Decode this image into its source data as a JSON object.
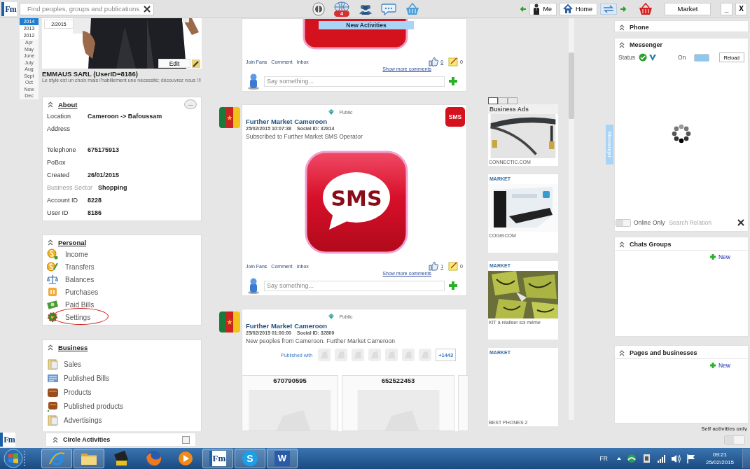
{
  "top_bar": {
    "logo": "Fm",
    "search": {
      "placeholder": "Find peoples, groups and publications"
    },
    "notification_count": "4",
    "nav_buttons": [
      {
        "kind": "me",
        "label": "Me"
      },
      {
        "kind": "home",
        "label": "Home"
      }
    ],
    "market_button": "Market",
    "window_buttons": [
      "_",
      "X"
    ]
  },
  "year_list": {
    "years": [
      {
        "label": "2014",
        "selected": true
      },
      {
        "label": "2013",
        "selected": false
      },
      {
        "label": "2012",
        "selected": false
      }
    ],
    "months": [
      "Apr",
      "May",
      "June",
      "July",
      "Aug",
      "Sept",
      "Oct",
      "Now",
      "Dec"
    ]
  },
  "profile": {
    "cover_date": "2/2015",
    "edit_button": "Edit",
    "name": "EMMAUS SARL (UserID=8186)",
    "slogan": "Le style est un choix mais l'habillement une nécessité; découvrez nous !!!"
  },
  "about": {
    "title": "About",
    "more_button": "...",
    "fields": [
      {
        "label": "Location",
        "value": "Cameroon -> Bafoussam",
        "dimmed": false
      },
      {
        "label": "Address",
        "dimmed": false
      },
      {
        "label": "Telephone",
        "value": "675175913",
        "dimmed": false
      },
      {
        "label": "PoBox",
        "dimmed": false
      },
      {
        "label": "Created",
        "value": "26/01/2015",
        "dimmed": false
      },
      {
        "label": "Business Sector",
        "value": "Shopping",
        "dimmed": true
      },
      {
        "label": "Account ID",
        "value": "8228",
        "dimmed": false
      },
      {
        "label": "User ID",
        "value": "8186",
        "dimmed": false
      }
    ]
  },
  "personal": {
    "title": "Personal",
    "items": [
      {
        "label": "Income",
        "circled": false
      },
      {
        "label": "Transfers",
        "circled": false
      },
      {
        "label": "Balances",
        "circled": false
      },
      {
        "label": "Purchases",
        "circled": false
      },
      {
        "label": "Paid Bills",
        "circled": false
      },
      {
        "label": "Settings",
        "circled": true
      }
    ]
  },
  "business": {
    "title": "Business",
    "items": [
      {
        "label": "Sales"
      },
      {
        "label": "Published Bills"
      },
      {
        "label": "Products"
      },
      {
        "label": "Published products"
      },
      {
        "label": "Advertisings"
      }
    ]
  },
  "feed": {
    "posts": [
      {
        "kind": "continued",
        "banner": "New Activities",
        "actions": [
          "Join Fans",
          "Comment",
          "Inbox"
        ],
        "likes": "0",
        "notes": "0",
        "show_more": "Show more comments",
        "comment_placeholder": "Say something..."
      },
      {
        "visibility": "Public",
        "author": "Further Market Cameroon",
        "date": "25/02/2015 10:07:38",
        "social_id": "Social ID: 32814",
        "text": "Subscribed to Further Market SMS Operator",
        "badge": "SMS",
        "image_text": "SMS",
        "actions": [
          "Join Fans",
          "Comment",
          "Inbox"
        ],
        "likes": "1",
        "notes": "0",
        "show_more": "Show more comments",
        "comment_placeholder": "Say something..."
      },
      {
        "kind": "contacts",
        "visibility": "Public",
        "author": "Further Market Cameroon",
        "date": "25/02/2015 01:00:00",
        "social_id": "Social ID: 32800",
        "text": "New peoples from Cameroon. Further Market Cameroon",
        "published_with": "Published with",
        "more_count": "+1443",
        "contacts": [
          {
            "number": "670790595"
          },
          {
            "number": "652522453"
          }
        ]
      }
    ]
  },
  "ads": {
    "tabs": [
      {
        "selected": true
      },
      {
        "selected": false
      },
      {
        "selected": false
      }
    ],
    "title": "Business Ads",
    "items": [
      {
        "kind": "picture",
        "caption": "CONNECTIC.COM"
      },
      {
        "kind": "picture",
        "category": "MARKET",
        "caption": "COGEICOM"
      },
      {
        "kind": "picture",
        "category": "MARKET",
        "caption": "KIT à réaliser soi même"
      },
      {
        "kind": "blank",
        "category": "MARKET",
        "caption": "BEST PHONES 2"
      }
    ]
  },
  "messenger_tab": "Messenger",
  "right_panel": {
    "phone": {
      "title": "Phone"
    },
    "messenger": {
      "title": "Messenger",
      "status_label": "Status",
      "on_label": "On",
      "toggle_on": true,
      "reload_button": "Reload",
      "online_only_label": "Online Only",
      "online_only": false,
      "search": {
        "placeholder": "Search Relation"
      }
    },
    "chats_groups": {
      "title": "Chats Groups",
      "new_button": "New"
    },
    "pages": {
      "title": "Pages and businesses",
      "new_button": "New"
    },
    "self_activities": {
      "label": "Self activities only",
      "on": false
    }
  },
  "bottom_bar": {
    "logo": "Fm",
    "circle_activities": {
      "title": "Circle Activities",
      "checked": false
    }
  },
  "taskbar": {
    "apps": [
      {
        "kind": "ie",
        "running": true
      },
      {
        "kind": "folder",
        "running": true
      },
      {
        "kind": "app",
        "running": false
      },
      {
        "kind": "firefox",
        "running": false
      },
      {
        "kind": "media",
        "running": false
      },
      {
        "kind": "fm",
        "label": "Fm",
        "running": true
      },
      {
        "kind": "skype",
        "label": "S",
        "running": true
      },
      {
        "kind": "word",
        "label": "W",
        "running": true
      }
    ],
    "language": "FR",
    "time": "09:21",
    "date": "25/02/2015"
  }
}
